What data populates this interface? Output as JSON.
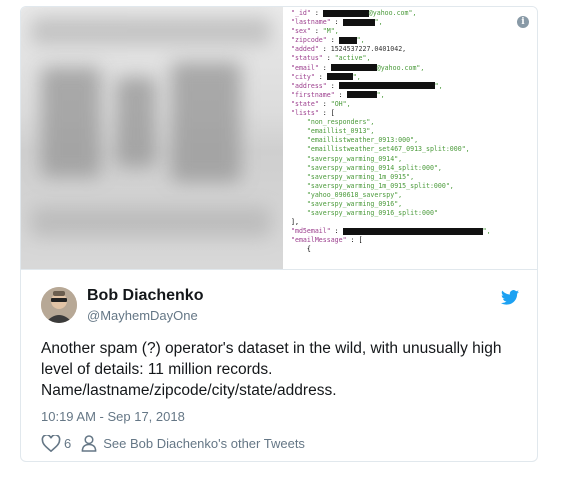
{
  "media": {
    "code_lines": [
      [
        [
          "key",
          "\"_id\""
        ],
        [
          "plain",
          " : "
        ],
        [
          "redact",
          ""
        ],
        [
          "str",
          "@yahoo.com\","
        ]
      ],
      [
        [
          "key",
          "\"lastname\""
        ],
        [
          "plain",
          " : "
        ],
        [
          "redact",
          ""
        ],
        [
          "str",
          "\","
        ]
      ],
      [
        [
          "key",
          "\"sex\""
        ],
        [
          "plain",
          " : "
        ],
        [
          "str",
          "\"M\","
        ]
      ],
      [
        [
          "key",
          "\"zipcode\""
        ],
        [
          "plain",
          " : "
        ],
        [
          "redact",
          ""
        ],
        [
          "str",
          "\","
        ]
      ],
      [
        [
          "key",
          "\"added\""
        ],
        [
          "plain",
          " : "
        ],
        [
          "num",
          "1524537227.0401042,"
        ]
      ],
      [
        [
          "key",
          "\"status\""
        ],
        [
          "plain",
          " : "
        ],
        [
          "str",
          "\"active\","
        ]
      ],
      [
        [
          "key",
          "\"email\""
        ],
        [
          "plain",
          " : "
        ],
        [
          "redact",
          ""
        ],
        [
          "str",
          "@yahoo.com\","
        ]
      ],
      [
        [
          "key",
          "\"city\""
        ],
        [
          "plain",
          " : "
        ],
        [
          "redact",
          ""
        ],
        [
          "str",
          "\","
        ]
      ],
      [
        [
          "key",
          "\"address\""
        ],
        [
          "plain",
          " : "
        ],
        [
          "redact",
          ""
        ],
        [
          "str",
          "\","
        ]
      ],
      [
        [
          "key",
          "\"firstname\""
        ],
        [
          "plain",
          " : "
        ],
        [
          "redact",
          ""
        ],
        [
          "str",
          "\","
        ]
      ],
      [
        [
          "key",
          "\"state\""
        ],
        [
          "plain",
          " : "
        ],
        [
          "str",
          "\"OH\","
        ]
      ],
      [
        [
          "key",
          "\"lists\""
        ],
        [
          "plain",
          " : ["
        ]
      ],
      [
        [
          "str",
          "    \"non_responders\","
        ]
      ],
      [
        [
          "str",
          "    \"emaillist_0913\","
        ]
      ],
      [
        [
          "str",
          "    \"emaillistweather_0913:000\","
        ]
      ],
      [
        [
          "str",
          "    \"emaillistweather_set467_0913_split:000\","
        ]
      ],
      [
        [
          "str",
          "    \"saverspy_warming_0914\","
        ]
      ],
      [
        [
          "str",
          "    \"saverspy_warming_0914_split:000\","
        ]
      ],
      [
        [
          "str",
          "    \"saverspy_warming_1m_0915\","
        ]
      ],
      [
        [
          "str",
          "    \"saverspy_warming_1m_0915_split:000\","
        ]
      ],
      [
        [
          "str",
          "    \"yahoo_090618_saverspy\","
        ]
      ],
      [
        [
          "str",
          "    \"saverspy_warming_0916\","
        ]
      ],
      [
        [
          "str",
          "    \"saverspy_warming_0916_split:000\""
        ]
      ],
      [
        [
          "plain",
          "],"
        ]
      ],
      [
        [
          "key",
          "\"md5email\""
        ],
        [
          "plain",
          " : "
        ],
        [
          "redact",
          ""
        ],
        [
          "str",
          "\","
        ]
      ],
      [
        [
          "key",
          "\"emailMessage\""
        ],
        [
          "plain",
          " : ["
        ]
      ],
      [
        [
          "plain",
          "    {"
        ]
      ]
    ],
    "info_icon": "info-icon"
  },
  "tweet": {
    "name": "Bob Diachenko",
    "handle": "@MayhemDayOne",
    "text_lines": [
      "Another spam (?) operator's dataset in the wild, with unusually high",
      "level of details: 11 million records.",
      "Name/lastname/zipcode/city/state/address."
    ],
    "timestamp": "10:19 AM - Sep 17, 2018",
    "like_count": "6",
    "other_tweets_label": "See Bob Diachenko's other Tweets",
    "brand_color": "#1da1f2",
    "icons": [
      "twitter-bird-icon",
      "heart-icon",
      "person-icon"
    ]
  }
}
